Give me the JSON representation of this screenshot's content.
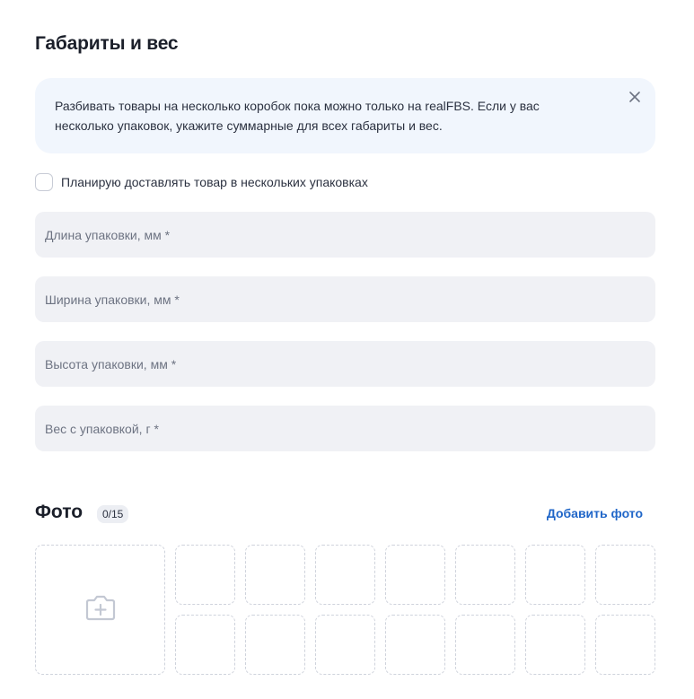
{
  "dimensions_section": {
    "title": "Габариты и вес",
    "banner": {
      "text": "Разбивать товары на несколько коробок пока можно только на realFBS. Если у вас несколько упаковок, укажите суммарные для всех габариты и вес.",
      "close_icon": "close-icon"
    },
    "multi_package_checkbox": {
      "label": "Планирую доставлять товар в нескольких упаковках",
      "checked": false
    },
    "fields": {
      "length": {
        "value": "",
        "placeholder": "Длина упаковки, мм *"
      },
      "width": {
        "value": "",
        "placeholder": "Ширина упаковки, мм *"
      },
      "height": {
        "value": "",
        "placeholder": "Высота упаковки, мм *"
      },
      "weight": {
        "value": "",
        "placeholder": "Вес с упаковкой, г *"
      }
    }
  },
  "photo_section": {
    "title": "Фото",
    "count": "0/15",
    "add_link": "Добавить фото",
    "main_slot_icon": "add-photo-icon"
  },
  "colors": {
    "accent": "#2066c8",
    "banner_bg": "#f1f6fd",
    "field_bg": "#f0f1f5",
    "text": "#1b1f2a"
  }
}
